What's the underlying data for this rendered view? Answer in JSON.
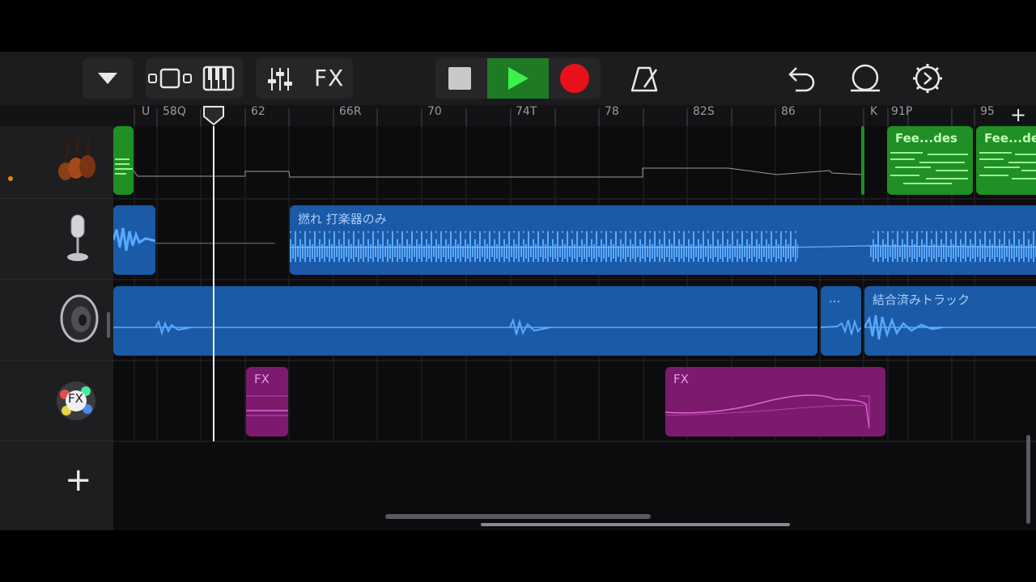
{
  "toolbar": {
    "fx_label": "FX",
    "icons": [
      "dropdown-icon",
      "tracks-view-icon",
      "keyboard-icon",
      "mixer-icon",
      "stop-icon",
      "play-icon",
      "record-icon",
      "metronome-icon",
      "undo-icon",
      "loop-icon",
      "settings-icon"
    ]
  },
  "ruler": {
    "bar_labels": [
      "U",
      "58Q",
      "62",
      "66R",
      "70",
      "74T",
      "78",
      "82S",
      "86",
      "K",
      "91P",
      "95"
    ],
    "add_button": "+"
  },
  "tracks": [
    {
      "instrument": "strings",
      "icon": "violin-icon"
    },
    {
      "instrument": "microphone",
      "icon": "microphone-icon"
    },
    {
      "instrument": "speaker",
      "icon": "speaker-icon"
    },
    {
      "instrument": "fx",
      "icon": "fx-icon",
      "icon_text": "FX"
    }
  ],
  "regions": {
    "strings_1": "Fee...des",
    "strings_2": "Fee...des",
    "mic_1": "撚れ 打楽器のみ",
    "speaker_2": "...",
    "speaker_3": "結合済みトラック",
    "fx_1": "FX",
    "fx_2": "FX"
  },
  "add_track": "+",
  "colors": {
    "audio_region": "#1a5aa6",
    "waveform": "#5aa8ff",
    "midi_region": "#1f8f26",
    "fx_region": "#7c1a6e",
    "play_button": "#1e7a24",
    "record": "#e8101a"
  }
}
